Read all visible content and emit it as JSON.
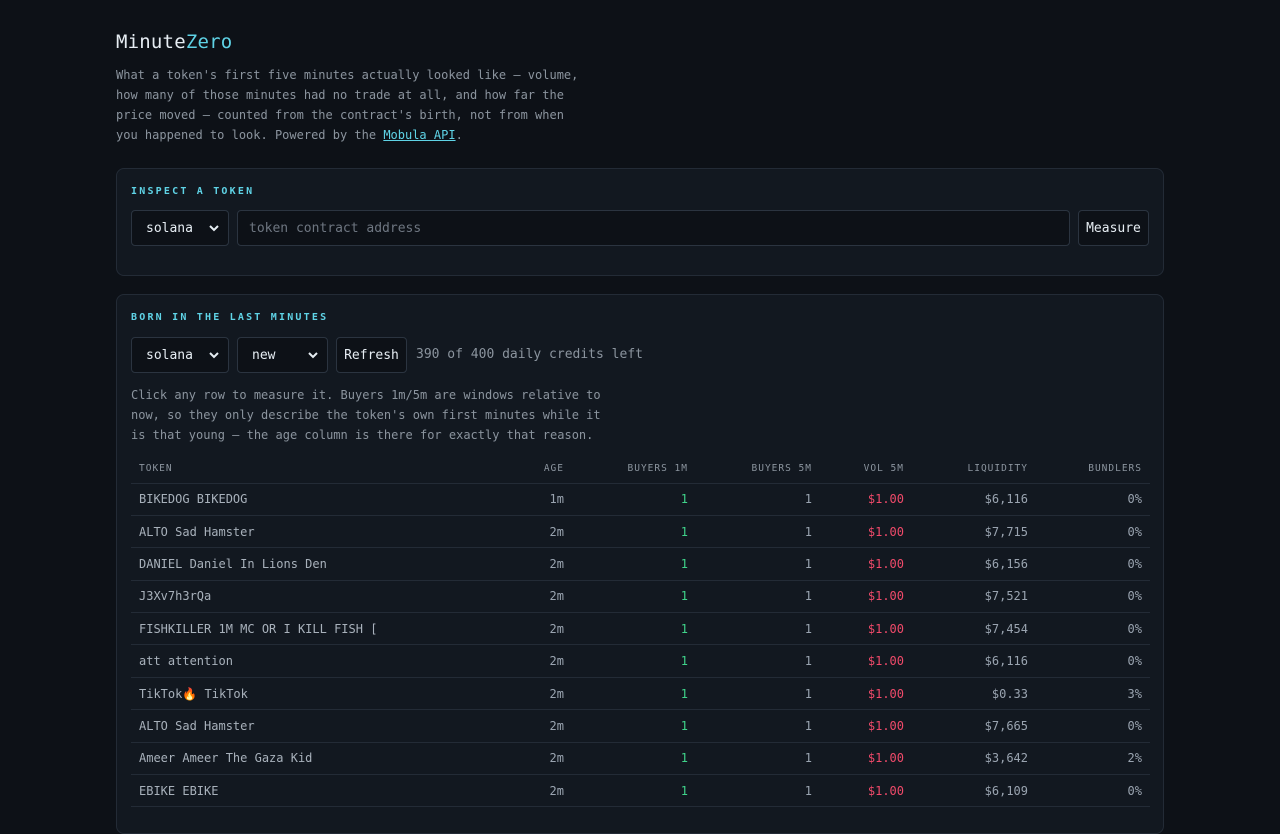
{
  "brand": {
    "name_main": "Minute",
    "name_accent": "Zero"
  },
  "intro": {
    "text": "What a token's first five minutes actually looked like — volume, how many of those minutes had no trade at all, and how far the price moved — counted from the contract's birth, not from when you happened to look. Powered by the ",
    "link": "Mobula API",
    "end": "."
  },
  "inspect": {
    "title": "INSPECT A TOKEN",
    "chain_value": "solana",
    "address_placeholder": "token contract address",
    "measure_label": "Measure"
  },
  "born": {
    "title": "BORN IN THE LAST MINUTES",
    "chain_value": "solana",
    "sort_value": "new",
    "refresh_label": "Refresh",
    "credits_text": "390 of 400 daily credits left",
    "help_text": "Click any row to measure it. Buyers 1m/5m are windows relative to now, so they only describe the token's own first minutes while it is that young — the age column is there for exactly that reason.",
    "columns": [
      "TOKEN",
      "AGE",
      "BUYERS 1M",
      "BUYERS 5M",
      "VOL 5M",
      "LIQUIDITY",
      "BUNDLERS"
    ],
    "rows": [
      {
        "token": "BIKEDOG BIKEDOG",
        "age": "1m",
        "b1": "1",
        "b5": "1",
        "vol": "$1.00",
        "liq": "$6,116",
        "bund": "0%"
      },
      {
        "token": "ALTO Sad Hamster",
        "age": "2m",
        "b1": "1",
        "b5": "1",
        "vol": "$1.00",
        "liq": "$7,715",
        "bund": "0%"
      },
      {
        "token": "DANIEL Daniel In Lions Den",
        "age": "2m",
        "b1": "1",
        "b5": "1",
        "vol": "$1.00",
        "liq": "$6,156",
        "bund": "0%"
      },
      {
        "token": "J3Xv7h3rQa",
        "age": "2m",
        "b1": "1",
        "b5": "1",
        "vol": "$1.00",
        "liq": "$7,521",
        "bund": "0%"
      },
      {
        "token": "FISHKILLER 1M MC OR I KILL FISH [",
        "age": "2m",
        "b1": "1",
        "b5": "1",
        "vol": "$1.00",
        "liq": "$7,454",
        "bund": "0%"
      },
      {
        "token": "att attention",
        "age": "2m",
        "b1": "1",
        "b5": "1",
        "vol": "$1.00",
        "liq": "$6,116",
        "bund": "0%"
      },
      {
        "token": "TikTok🔥 TikTok",
        "age": "2m",
        "b1": "1",
        "b5": "1",
        "vol": "$1.00",
        "liq": "$0.33",
        "bund": "3%"
      },
      {
        "token": "ALTO Sad Hamster",
        "age": "2m",
        "b1": "1",
        "b5": "1",
        "vol": "$1.00",
        "liq": "$7,665",
        "bund": "0%"
      },
      {
        "token": "Ameer Ameer The Gaza Kid",
        "age": "2m",
        "b1": "1",
        "b5": "1",
        "vol": "$1.00",
        "liq": "$3,642",
        "bund": "2%"
      },
      {
        "token": "EBIKE EBIKE",
        "age": "2m",
        "b1": "1",
        "b5": "1",
        "vol": "$1.00",
        "liq": "$6,109",
        "bund": "0%"
      }
    ]
  },
  "colors": {
    "accent": "#5fd3e6",
    "up": "#3fd38a",
    "down": "#f04a6a"
  }
}
